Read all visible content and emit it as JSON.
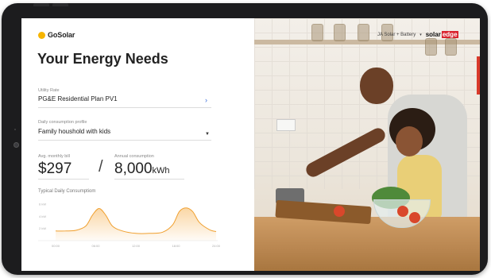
{
  "app": {
    "logo_text": "GoSolar",
    "accent_color": "#f7b500",
    "link_color": "#3b6fd8"
  },
  "form": {
    "title": "Your Energy Needs",
    "utility_rate": {
      "label": "Utility Rate",
      "value": "PG&E Residential Plan PV1",
      "icon": "chevron-right-icon"
    },
    "consumption_profile": {
      "label": "Daily consumption profile",
      "value": "Family houshold with kids",
      "icon": "caret-down-icon"
    },
    "monthly_bill": {
      "label": "Avg. monthly bill",
      "value": "$297"
    },
    "separator": "/",
    "annual_consumption": {
      "label": "Annual consumption",
      "value": "8,000",
      "unit": "kWh"
    }
  },
  "chart_data": {
    "type": "area",
    "title": "Typical Daily Consumptiom",
    "y_ticks": [
      "6 kW",
      "4 kW",
      "2 kW"
    ],
    "x_ticks": [
      "00:00",
      "06:00",
      "12:00",
      "18:00",
      "24:00"
    ],
    "x": [
      0,
      1.5,
      3,
      4.5,
      5.5,
      6.5,
      7.5,
      8.5,
      10,
      12,
      14,
      16,
      17.5,
      18.5,
      19.5,
      20.5,
      21.5,
      23,
      24
    ],
    "y": [
      1.6,
      1.6,
      1.7,
      2.4,
      4.2,
      5.3,
      4.2,
      2.4,
      1.6,
      1.2,
      1.2,
      1.4,
      2.6,
      4.8,
      5.4,
      4.8,
      3.0,
      1.8,
      1.5
    ],
    "ylim": [
      0,
      6.8
    ],
    "xlim": [
      0,
      24
    ],
    "color": "#f0a030"
  },
  "photo": {
    "system_select": "JA Solar + Battery",
    "brand_prefix": "solar",
    "brand_suffix": "edge",
    "brand_color": "#d9232e"
  }
}
